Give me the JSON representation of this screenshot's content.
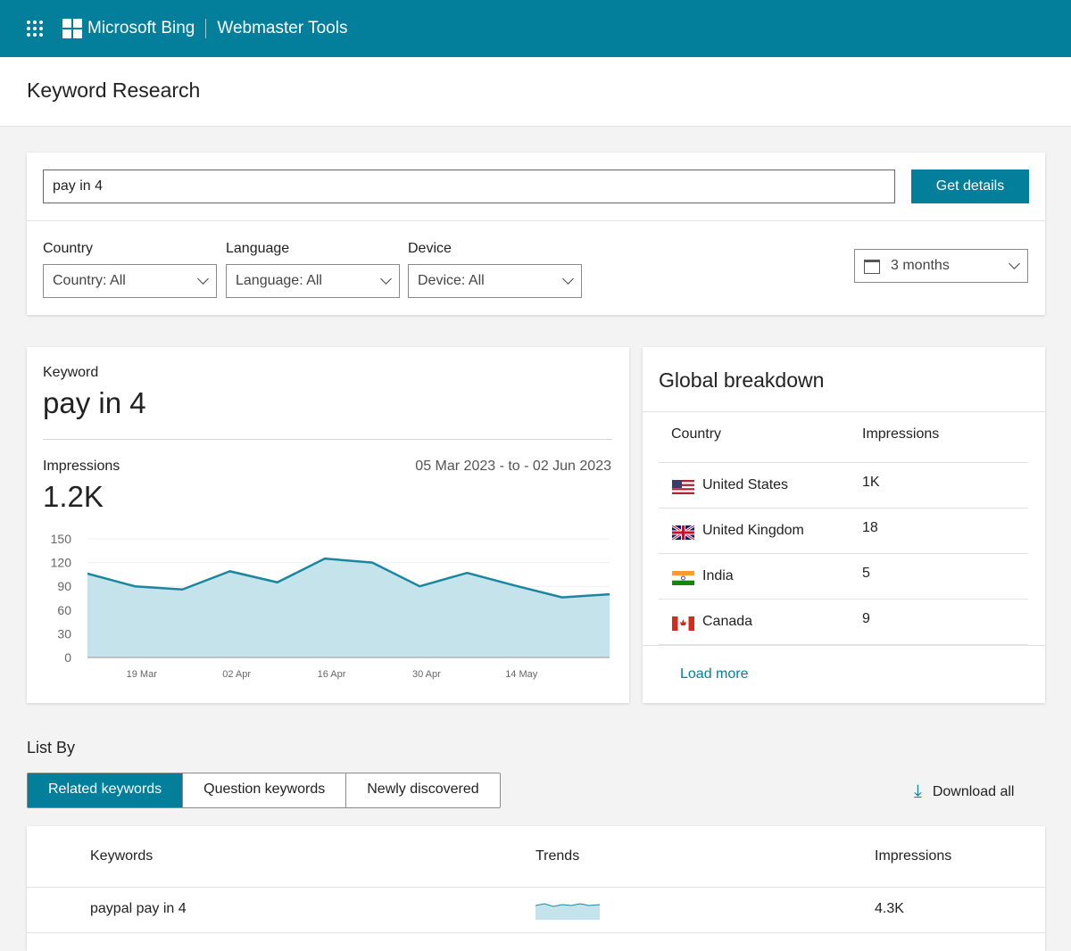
{
  "topbar": {
    "brand": "Microsoft Bing",
    "product": "Webmaster Tools"
  },
  "page_title": "Keyword Research",
  "search": {
    "value": "pay in 4",
    "button": "Get details"
  },
  "filters": {
    "country": {
      "label": "Country",
      "value": "Country: All"
    },
    "language": {
      "label": "Language",
      "value": "Language: All"
    },
    "device": {
      "label": "Device",
      "value": "Device: All"
    },
    "range": {
      "value": "3 months"
    }
  },
  "keyword_card": {
    "label": "Keyword",
    "keyword": "pay in 4",
    "impressions_label": "Impressions",
    "date_range": "05 Mar 2023 - to - 02 Jun 2023",
    "impressions": "1.2K"
  },
  "chart_data": {
    "type": "area",
    "x": [
      "2023-03-11",
      "2023-03-18",
      "2023-03-25",
      "2023-04-01",
      "2023-04-08",
      "2023-04-15",
      "2023-04-22",
      "2023-04-29",
      "2023-05-06",
      "2023-05-13",
      "2023-05-20",
      "2023-05-27"
    ],
    "values": [
      106,
      90,
      86,
      109,
      95,
      125,
      120,
      90,
      107,
      91,
      76,
      80
    ],
    "ylim": [
      0,
      150
    ],
    "yticks": [
      "0",
      "30",
      "60",
      "90",
      "120",
      "150"
    ],
    "xticks": [
      "19 Mar",
      "02 Apr",
      "16 Apr",
      "30 Apr",
      "14 May"
    ],
    "grid": true,
    "colors": {
      "line": "#1a86a0",
      "fill": "#c5e3ea"
    }
  },
  "global": {
    "title": "Global breakdown",
    "col_country": "Country",
    "col_impressions": "Impressions",
    "rows": [
      {
        "country": "United States",
        "impressions": "1K",
        "flag": "us-flag"
      },
      {
        "country": "United Kingdom",
        "impressions": "18",
        "flag": "uk-flag"
      },
      {
        "country": "India",
        "impressions": "5",
        "flag": "india-flag"
      },
      {
        "country": "Canada",
        "impressions": "9",
        "flag": "canada-flag"
      }
    ],
    "load_more": "Load more"
  },
  "list": {
    "label": "List By",
    "tabs": [
      "Related keywords",
      "Question keywords",
      "Newly discovered"
    ],
    "download": "Download all"
  },
  "table": {
    "headers": [
      "Keywords",
      "Trends",
      "Impressions"
    ],
    "rows": [
      {
        "keyword": "paypal pay in 4",
        "impressions": "4.3K"
      }
    ]
  },
  "accent": "#037f9c"
}
